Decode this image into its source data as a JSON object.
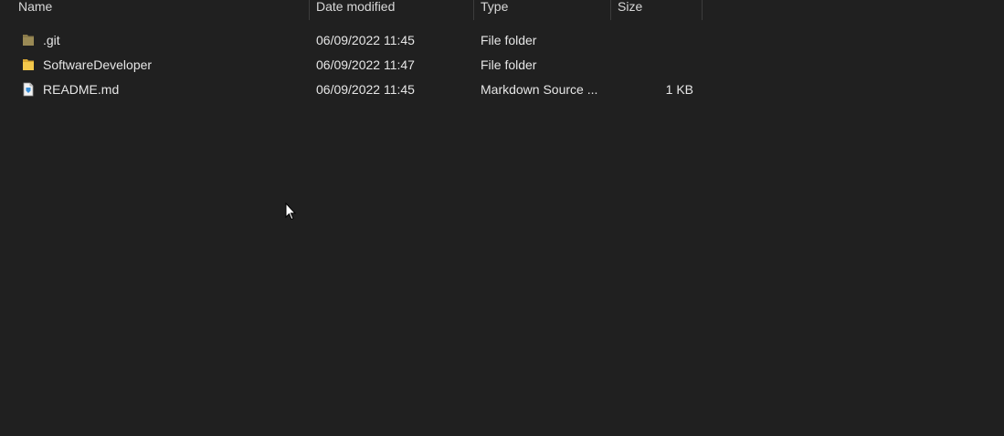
{
  "columns": {
    "name": "Name",
    "date": "Date modified",
    "type": "Type",
    "size": "Size"
  },
  "files": [
    {
      "name": ".git",
      "date": "06/09/2022 11:45",
      "type": "File folder",
      "size": "",
      "icon": "hidden-folder-icon",
      "icon_color": "#8a7a4a"
    },
    {
      "name": "SoftwareDeveloper",
      "date": "06/09/2022 11:47",
      "type": "File folder",
      "size": "",
      "icon": "folder-icon",
      "icon_color": "#f3c84b"
    },
    {
      "name": "README.md",
      "date": "06/09/2022 11:45",
      "type": "Markdown Source ...",
      "size": "1 KB",
      "icon": "markdown-file-icon",
      "icon_color": "#3a8fd6"
    }
  ],
  "colors": {
    "background": "#202020",
    "text": "#e6e6e6",
    "separator": "#3c3c3c"
  }
}
